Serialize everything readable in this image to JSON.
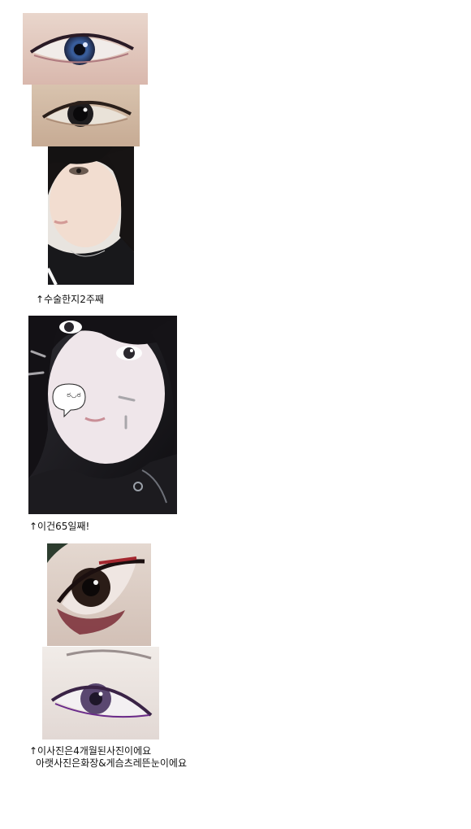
{
  "captions": {
    "two_weeks": "↑수술한지2주째",
    "day65": "↑이건65일째!",
    "four_months_line1": "↑이사진은4개월된사진이에요",
    "four_months_line2": "아랫사진은화장&게슴츠레뜬눈이에요"
  },
  "sticker": {
    "text": "ಠ◡ಠ"
  }
}
